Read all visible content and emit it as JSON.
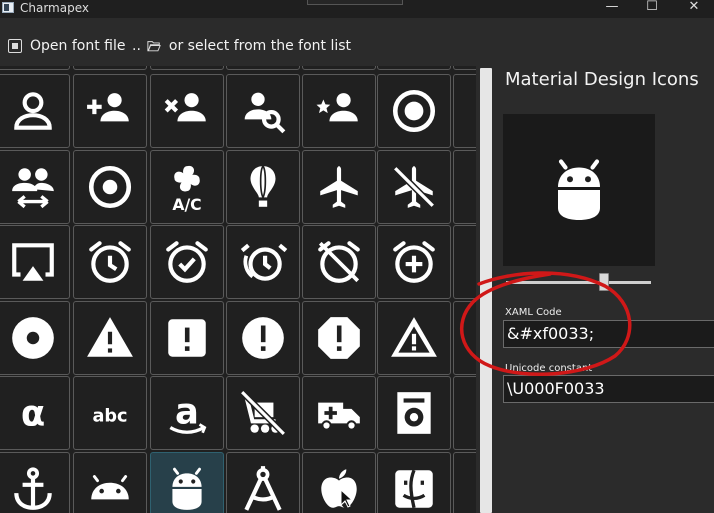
{
  "window": {
    "title": "Charmapex",
    "minimize_glyph": "—",
    "maximize_glyph": "☐",
    "close_glyph": "✕"
  },
  "toolbar": {
    "open_font_label": "Open font file",
    "separator_label": "..",
    "select_font_label": "or select from the font list"
  },
  "details": {
    "font_name": "Material Design Icons",
    "xaml_label": "XAML Code",
    "xaml_value": "&#xf0033;",
    "unicode_label": "Unicode constant",
    "unicode_value": "\\U000F0033"
  },
  "colors": {
    "annotation": "#d01818",
    "selected_cell": "#27404a"
  },
  "glyph_grid": {
    "rows": [
      [
        "account-icon",
        "account-plus-icon",
        "account-remove-icon",
        "account-search-icon",
        "account-star-icon",
        "adjust-icon"
      ],
      [
        "account-switch-icon",
        "album-icon",
        "air-conditioner-icon",
        "airballoon-icon",
        "airplane-icon",
        "airplane-off-icon"
      ],
      [
        "airplay-icon",
        "alarm-icon",
        "alarm-check-icon",
        "alarm-multiple-icon",
        "alarm-off-icon",
        "alarm-plus-icon"
      ],
      [
        "album-icon",
        "alert-icon",
        "alert-box-icon",
        "alert-circle-icon",
        "alert-octagon-icon",
        "alert-outline-icon"
      ],
      [
        "alpha-icon",
        "alphabetical-icon",
        "amazon-icon",
        "trolley-off-icon",
        "ambulance-icon",
        "amplifier-icon"
      ],
      [
        "anchor-icon",
        "android-icon",
        "android-icon",
        "drawing-compass-icon",
        "apple-icon",
        "apple-finder-icon"
      ]
    ],
    "selected": "android-icon"
  }
}
